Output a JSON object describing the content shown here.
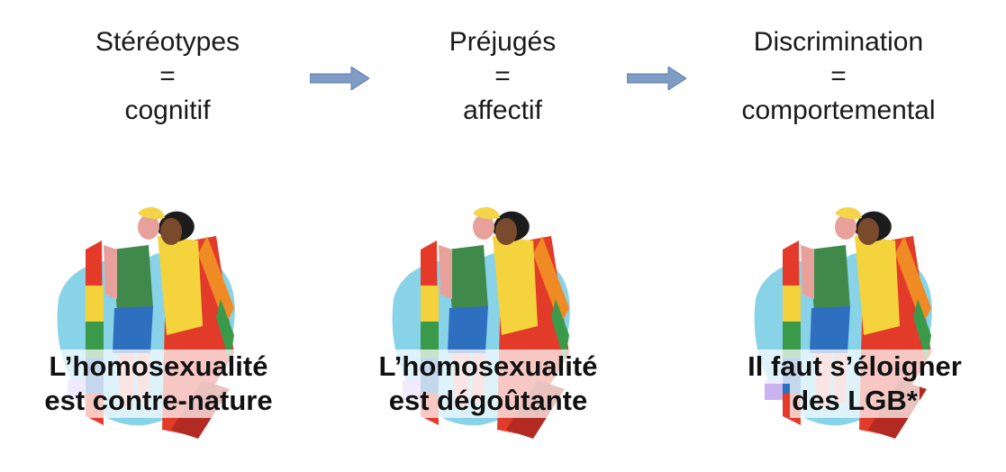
{
  "columns": [
    {
      "heading": [
        "Stéréotypes",
        "=",
        "cognitif"
      ],
      "caption": [
        "L’homosexualité",
        "est contre-nature"
      ]
    },
    {
      "heading": [
        "Préjugés",
        "=",
        "affectif"
      ],
      "caption": [
        "L’homosexualité",
        "est dégoûtante"
      ]
    },
    {
      "heading": [
        "Discrimination",
        "=",
        "comportemental"
      ],
      "caption": [
        "Il faut s’éloigner",
        "des LGB*"
      ]
    }
  ],
  "arrows": {
    "icon": "right-arrow-icon",
    "color": "#7f9cc4"
  },
  "illustration": {
    "icon": "couple-with-rainbow-flag-illustration"
  }
}
